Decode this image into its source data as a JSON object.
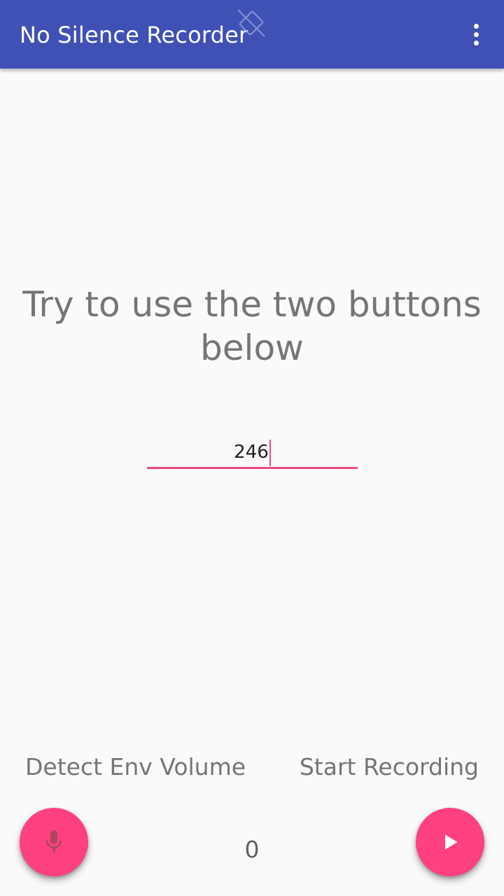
{
  "app_bar": {
    "title": "No Silence Recorder",
    "background_color": "#3f51b5",
    "status_icon": "no-signal-icon",
    "menu_icon": "more-vert-icon"
  },
  "main": {
    "headline": "Try to use the two buttons below",
    "input": {
      "value": "246",
      "accent_color": "#e94a86"
    }
  },
  "bottom": {
    "left_label": "Detect Env Volume",
    "right_label": "Start Recording",
    "counter": "0",
    "left_fab_icon": "microphone-icon",
    "right_fab_icon": "play-icon",
    "fab_color": "#ff4081"
  }
}
